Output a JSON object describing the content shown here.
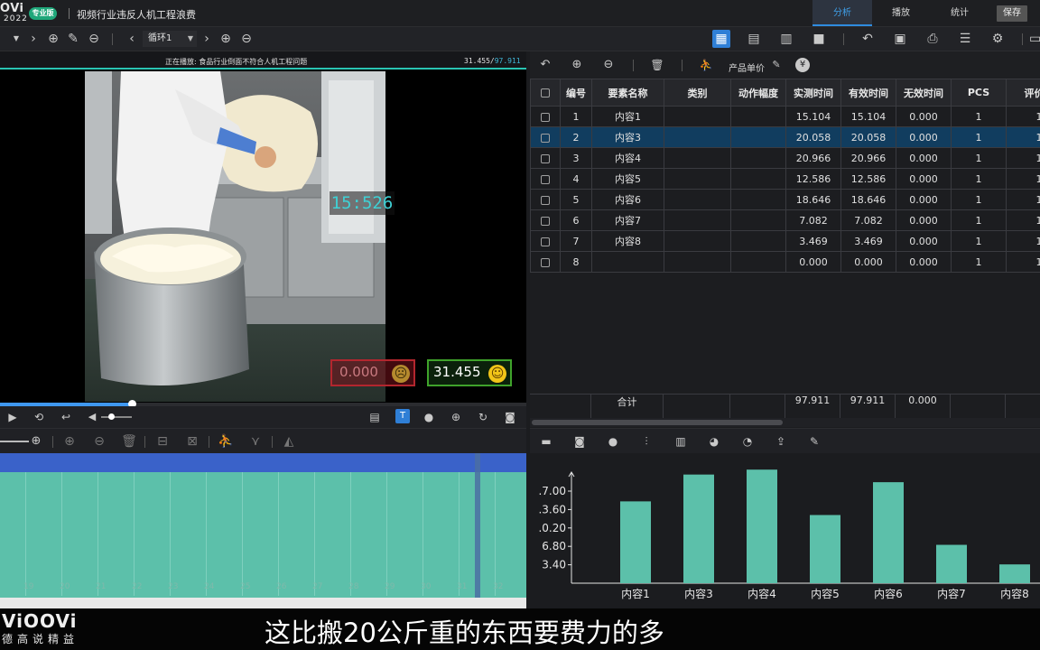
{
  "app": {
    "logo_line1": "OVi",
    "logo_line2": "2022",
    "edition": "专业版",
    "doc_title": "视频行业违反人机工程浪费"
  },
  "main_tabs": [
    "分析",
    "播放",
    "统计"
  ],
  "save_label": "保存",
  "toolbar": {
    "cycle": "循环1"
  },
  "video": {
    "caption": "正在播放: 食品行业倒面不符合人机工程问题",
    "time_current": "31.455/",
    "time_total": "97.911",
    "overlay_time": "15:526",
    "invalid_value": "0.000",
    "valid_value": "31.455",
    "progress": 0.25
  },
  "timeline": {
    "labels": [
      "19",
      "20",
      "21",
      "22",
      "23",
      "24",
      "25",
      "26",
      "27",
      "28",
      "29",
      "30",
      "31",
      "32"
    ]
  },
  "right_toolbar": {
    "unit_price": "产品单价"
  },
  "table": {
    "headers": [
      "编号",
      "要素名称",
      "类别",
      "动作幅度",
      "实测时间",
      "有效时间",
      "无效时间",
      "PCS",
      "评价系"
    ],
    "rows": [
      {
        "no": "1",
        "name": "内容1",
        "cat": "",
        "amp": "",
        "measured": "15.104",
        "valid": "15.104",
        "invalid": "0.000",
        "pcs": "1",
        "rate": "1"
      },
      {
        "no": "2",
        "name": "内容3",
        "cat": "",
        "amp": "",
        "measured": "20.058",
        "valid": "20.058",
        "invalid": "0.000",
        "pcs": "1",
        "rate": "1"
      },
      {
        "no": "3",
        "name": "内容4",
        "cat": "",
        "amp": "",
        "measured": "20.966",
        "valid": "20.966",
        "invalid": "0.000",
        "pcs": "1",
        "rate": "1"
      },
      {
        "no": "4",
        "name": "内容5",
        "cat": "",
        "amp": "",
        "measured": "12.586",
        "valid": "12.586",
        "invalid": "0.000",
        "pcs": "1",
        "rate": "1"
      },
      {
        "no": "5",
        "name": "内容6",
        "cat": "",
        "amp": "",
        "measured": "18.646",
        "valid": "18.646",
        "invalid": "0.000",
        "pcs": "1",
        "rate": "1"
      },
      {
        "no": "6",
        "name": "内容7",
        "cat": "",
        "amp": "",
        "measured": "7.082",
        "valid": "7.082",
        "invalid": "0.000",
        "pcs": "1",
        "rate": "1"
      },
      {
        "no": "7",
        "name": "内容8",
        "cat": "",
        "amp": "",
        "measured": "3.469",
        "valid": "3.469",
        "invalid": "0.000",
        "pcs": "1",
        "rate": "1"
      },
      {
        "no": "8",
        "name": "",
        "cat": "",
        "amp": "",
        "measured": "0.000",
        "valid": "0.000",
        "invalid": "0.000",
        "pcs": "1",
        "rate": "1"
      }
    ],
    "selected_row": 1,
    "totals": {
      "label": "合计",
      "measured": "97.911",
      "valid": "97.911",
      "invalid": "0.000"
    }
  },
  "chart_data": {
    "type": "bar",
    "categories": [
      "内容1",
      "内容3",
      "内容4",
      "内容5",
      "内容6",
      "内容7",
      "内容8"
    ],
    "values": [
      15.104,
      20.058,
      20.966,
      12.586,
      18.646,
      7.082,
      3.469
    ],
    "ytick_labels": [
      ".7.00",
      ".3.60",
      ".0.20",
      "6.80",
      "3.40"
    ],
    "ytick_values": [
      17.0,
      13.6,
      10.2,
      6.8,
      3.4
    ],
    "ylim": [
      0,
      21.5
    ],
    "bar_color": "#5cc0aa"
  },
  "footer": {
    "brand": "ViOOVi",
    "brand_sub": "德高说精益",
    "subtitle": "这比搬20公斤重的东西要费力的多"
  },
  "colors": {
    "accent": "#2f8ce0",
    "teal": "#29c4b3",
    "selected_row": "#113d5f"
  }
}
